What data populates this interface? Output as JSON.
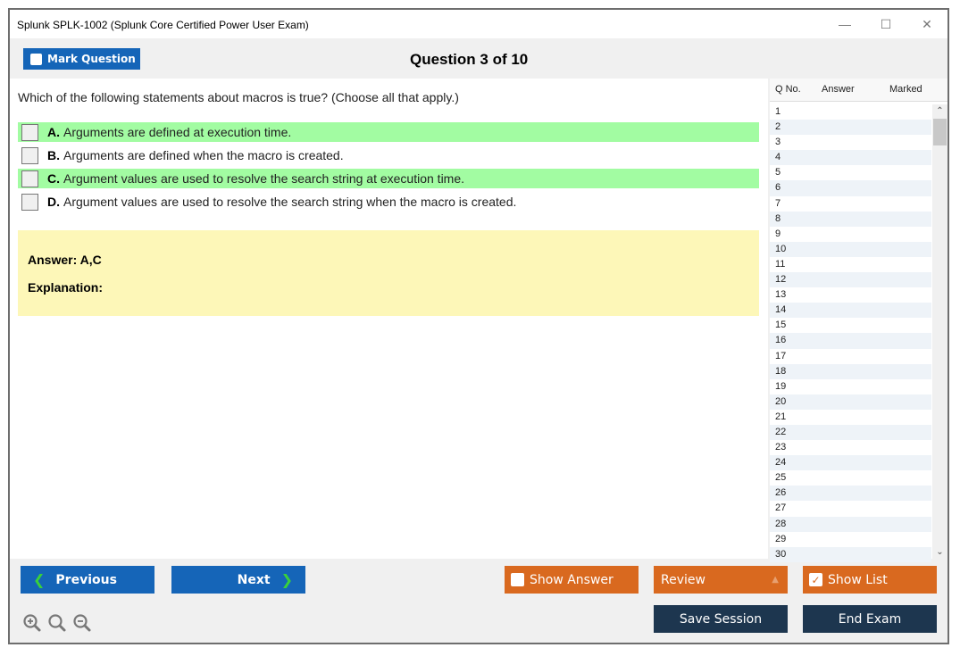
{
  "window": {
    "title": "Splunk SPLK-1002 (Splunk Core Certified Power User Exam)",
    "controls": {
      "minimize": "—",
      "maximize": "☐",
      "close": "✕"
    }
  },
  "header": {
    "mark_label": "Mark Question",
    "question_counter": "Question 3 of 10"
  },
  "question": {
    "text": "Which of the following statements about macros is true? (Choose all that apply.)",
    "options": [
      {
        "letter": "A.",
        "text": "Arguments are defined at execution time.",
        "correct": true
      },
      {
        "letter": "B.",
        "text": "Arguments are defined when the macro is created.",
        "correct": false
      },
      {
        "letter": "C.",
        "text": "Argument values are used to resolve the search string at execution time.",
        "correct": true
      },
      {
        "letter": "D.",
        "text": "Argument values are used to resolve the search string when the macro is created.",
        "correct": false
      }
    ],
    "answer": "Answer: A,C",
    "explanation": "Explanation:"
  },
  "question_list": {
    "headers": {
      "qno": "Q No.",
      "answer": "Answer",
      "marked": "Marked"
    },
    "rows": [
      "1",
      "2",
      "3",
      "4",
      "5",
      "6",
      "7",
      "8",
      "9",
      "10",
      "11",
      "12",
      "13",
      "14",
      "15",
      "16",
      "17",
      "18",
      "19",
      "20",
      "21",
      "22",
      "23",
      "24",
      "25",
      "26",
      "27",
      "28",
      "29",
      "30"
    ]
  },
  "footer": {
    "previous": "Previous",
    "next": "Next",
    "show_answer": "Show Answer",
    "review": "Review",
    "show_list": "Show List",
    "save_session": "Save Session",
    "end_exam": "End Exam"
  },
  "colors": {
    "primary_blue": "#1565b8",
    "orange": "#d9691f",
    "navy": "#1d364f",
    "correct_green": "#a2fca2",
    "answer_yellow": "#fdf7b8"
  }
}
